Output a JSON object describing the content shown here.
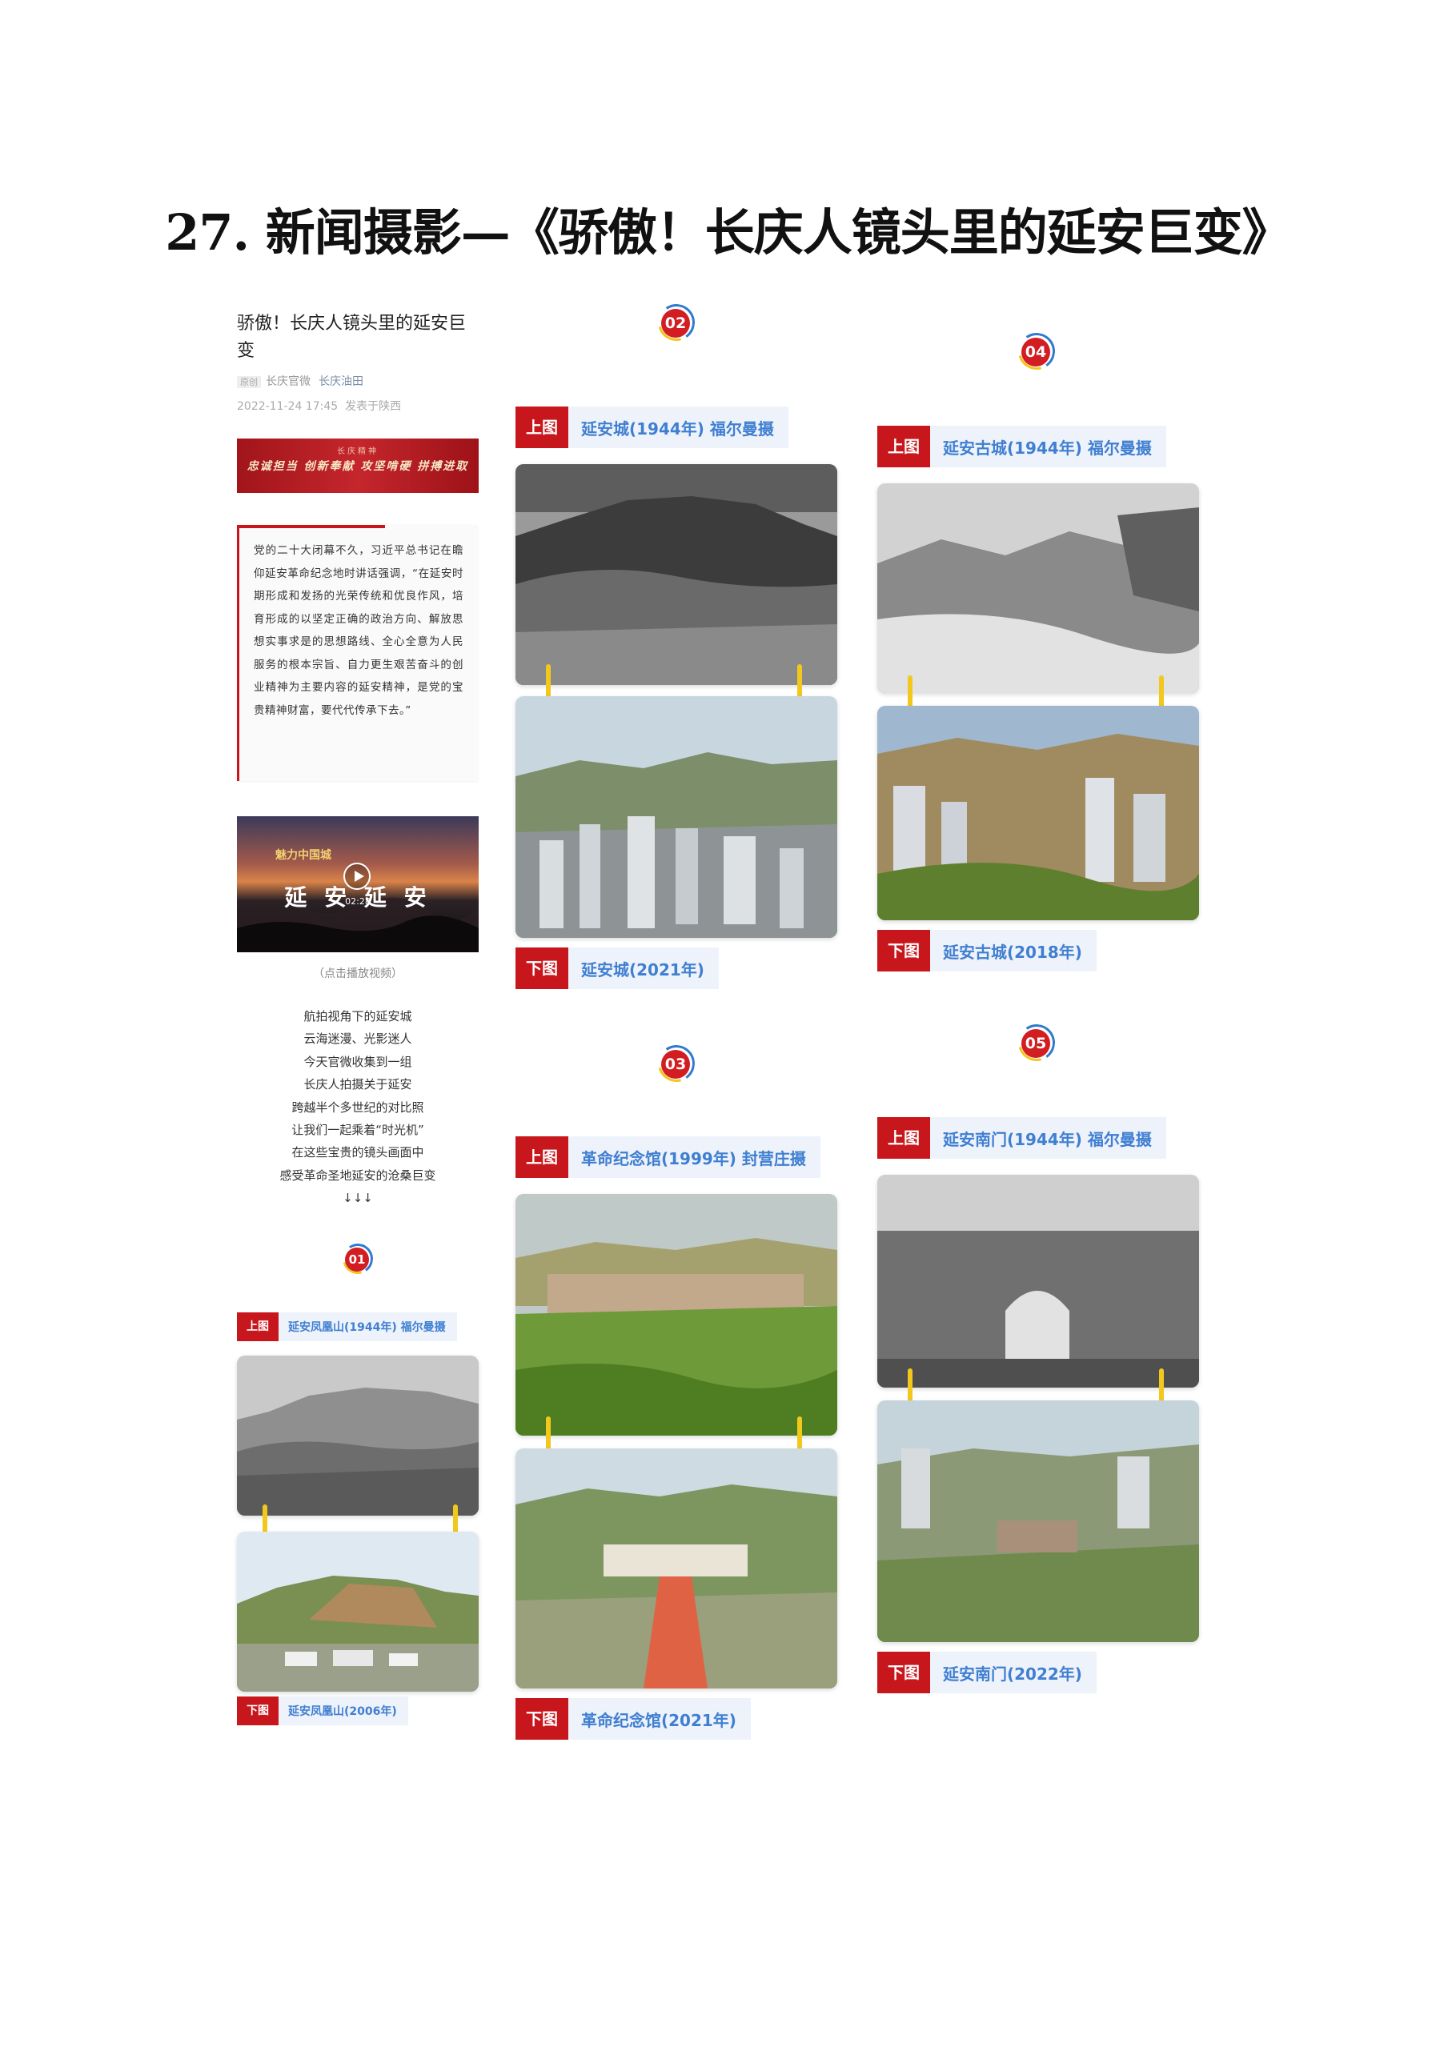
{
  "page": {
    "title": "27. 新闻摄影—《骄傲！长庆人镜头里的延安巨变》"
  },
  "article": {
    "title": "骄傲！长庆人镜头里的延安巨变",
    "tag": "原创",
    "account": "长庆官微",
    "author": "长庆油田",
    "datetime": "2022-11-24 17:45",
    "location": "发表于陕西",
    "banner_small": "长庆精神",
    "banner_main": "忠诚担当 创新奉献 攻坚啃硬 拼搏进取",
    "quote": "党的二十大闭幕不久，习近平总书记在瞻仰延安革命纪念地时讲话强调，“在延安时期形成和发扬的光荣传统和优良作风，培育形成的以坚定正确的政治方向、解放思想实事求是的思想路线、全心全意为人民服务的根本宗旨、自力更生艰苦奋斗的创业精神为主要内容的延安精神，是党的宝贵精神财富，要代代传承下去。”",
    "video": {
      "brand": "魅力中国城",
      "title": "延 安 延 安",
      "duration": "02:28"
    },
    "video_caption": "（点击播放视频）",
    "poem": [
      "航拍视角下的延安城",
      "云海迷漫、光影迷人",
      "今天官微收集到一组",
      "长庆人拍摄关于延安",
      "跨越半个多世纪的对比照",
      "让我们一起乘着“时光机”",
      "在这些宝贵的镜头画面中",
      "感受革命圣地延安的沧桑巨变",
      "↓↓↓"
    ]
  },
  "sections": [
    {
      "number": "01",
      "top_tag": "上图",
      "top_caption": "延安凤凰山(1944年) 福尔曼摄",
      "bottom_tag": "下图",
      "bottom_caption": "延安凤凰山(2006年)"
    },
    {
      "number": "02",
      "top_tag": "上图",
      "top_caption": "延安城(1944年) 福尔曼摄",
      "bottom_tag": "下图",
      "bottom_caption": "延安城(2021年)"
    },
    {
      "number": "03",
      "top_tag": "上图",
      "top_caption": "革命纪念馆(1999年) 封营庄摄",
      "bottom_tag": "下图",
      "bottom_caption": "革命纪念馆(2021年)"
    },
    {
      "number": "04",
      "top_tag": "上图",
      "top_caption": "延安古城(1944年) 福尔曼摄",
      "bottom_tag": "下图",
      "bottom_caption": "延安古城(2018年)"
    },
    {
      "number": "05",
      "top_tag": "上图",
      "top_caption": "延安南门(1944年) 福尔曼摄",
      "bottom_tag": "下图",
      "bottom_caption": "延安南门(2022年)"
    }
  ],
  "colors": {
    "accent_red": "#c8161d",
    "caption_blue": "#3f7fd1",
    "pin_yellow": "#f3c81c",
    "label_bg": "#eef2fb"
  }
}
